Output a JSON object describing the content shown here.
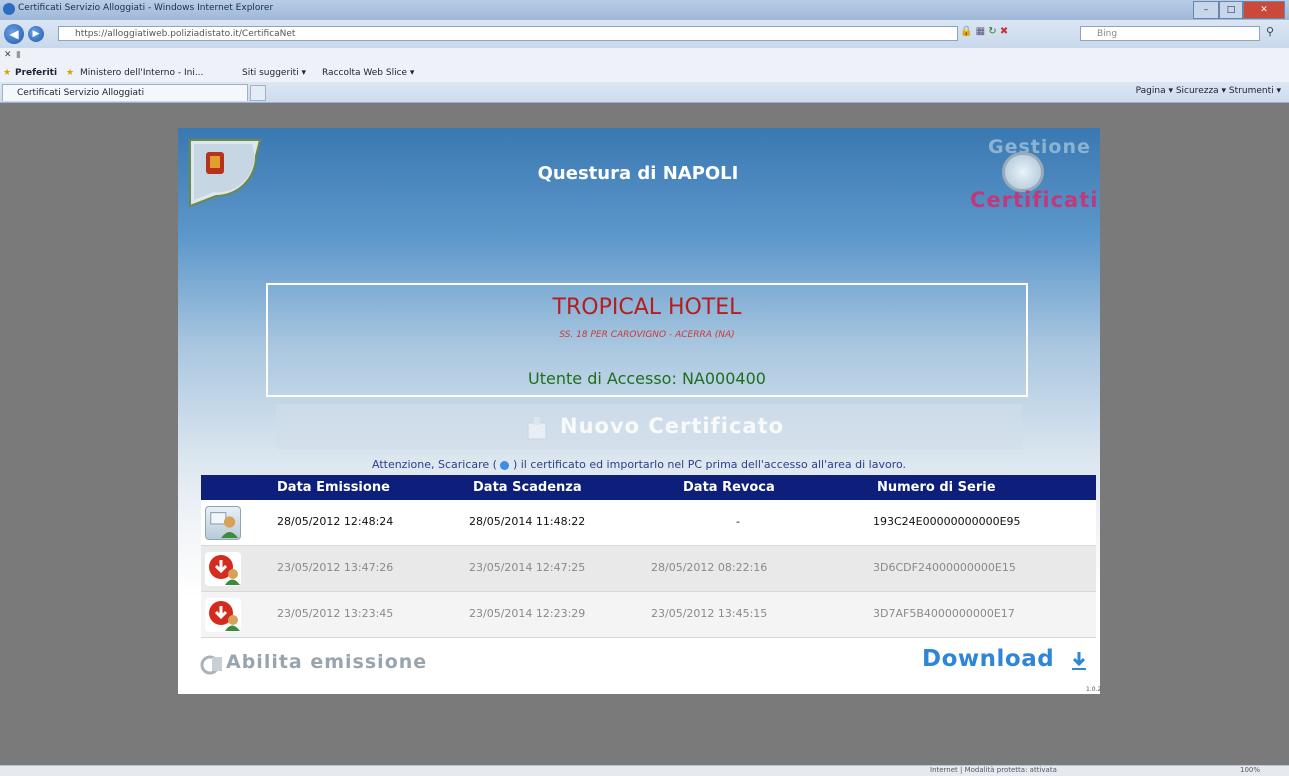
{
  "browser": {
    "window_title": "Certificati Servizio Alloggiati - Windows Internet Explorer",
    "address": "https://alloggiatiweb.poliziadistato.it/CertificaNet",
    "search_placeholder": "Bing",
    "favorites_label": "Preferiti",
    "fav_links": [
      "Ministero dell'Interno - Ini...",
      "Siti suggeriti ▾",
      "Raccolta Web Slice ▾"
    ],
    "tab_title": "Certificati Servizio Alloggiati",
    "toolbar_right": "Pagina ▾   Sicurezza ▾   Strumenti ▾",
    "status_zone": "Internet | Modalità protetta: attivata",
    "zoom": "100%"
  },
  "header": {
    "title": "Questura di NAPOLI",
    "logo_top": "Gestione",
    "logo_bottom": "Certificati"
  },
  "hotel": {
    "name": "TROPICAL HOTEL",
    "address": "SS. 18 PER CAROVIGNO - ACERRA (NA)",
    "user_line": "Utente di Accesso: NA000400"
  },
  "new_cert_label": "Nuovo Certificato",
  "attention": {
    "before": "Attenzione, Scaricare (",
    "after": ") il certificato ed importarlo nel PC prima dell'accesso all'area di lavoro."
  },
  "table": {
    "headers": [
      "Data Emissione",
      "Data Scadenza",
      "Data Revoca",
      "Numero di Serie"
    ],
    "rows": [
      {
        "status_icon": "certificate-icon",
        "emission": "28/05/2012 12:48:24",
        "expiry": "28/05/2014 11:48:22",
        "revocation": "-",
        "serial": "193C24E00000000000E95"
      },
      {
        "status_icon": "revoked-icon",
        "emission": "23/05/2012 13:47:26",
        "expiry": "23/05/2014 12:47:25",
        "revocation": "28/05/2012 08:22:16",
        "serial": "3D6CDF24000000000E15"
      },
      {
        "status_icon": "revoked-icon",
        "emission": "23/05/2012 13:23:45",
        "expiry": "23/05/2014 12:23:29",
        "revocation": "23/05/2012 13:45:15",
        "serial": "3D7AF5B4000000000E17"
      }
    ]
  },
  "footer": {
    "abilita_label": "Abilita emissione",
    "download_label": "Download",
    "version": "1.0.2"
  },
  "colors": {
    "header_blue": "#3a78b2",
    "table_header": "#0d1f7a",
    "hotel_red": "#b41e1e",
    "user_green": "#1e6e1e",
    "download_blue": "#2f86d8"
  }
}
